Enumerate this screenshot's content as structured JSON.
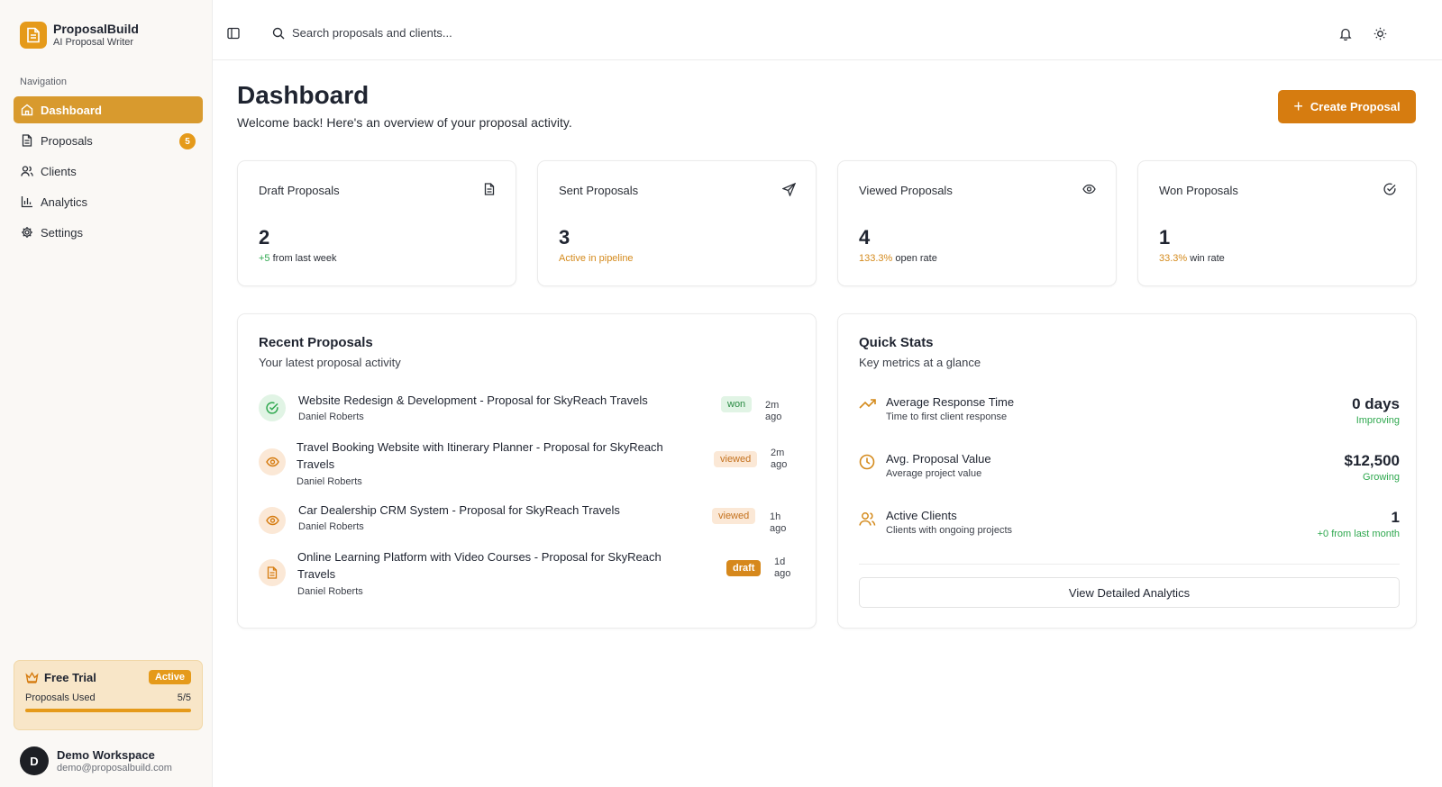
{
  "brand": {
    "name": "ProposalBuild",
    "tagline": "AI Proposal Writer"
  },
  "sidebar": {
    "section_label": "Navigation",
    "items": [
      {
        "label": "Dashboard",
        "icon": "home-icon",
        "active": true
      },
      {
        "label": "Proposals",
        "icon": "document-icon",
        "badge": "5"
      },
      {
        "label": "Clients",
        "icon": "users-icon"
      },
      {
        "label": "Analytics",
        "icon": "bar-chart-icon"
      },
      {
        "label": "Settings",
        "icon": "gear-icon"
      }
    ],
    "trial": {
      "title": "Free Trial",
      "status": "Active",
      "usage_label": "Proposals Used",
      "usage_value": "5/5",
      "usage_fraction": 1.0
    },
    "user": {
      "initial": "D",
      "name": "Demo Workspace",
      "email": "demo@proposalbuild.com"
    }
  },
  "header": {
    "search_placeholder": "Search proposals and clients..."
  },
  "page": {
    "title": "Dashboard",
    "subtitle": "Welcome back! Here's an overview of your proposal activity.",
    "create_button": "Create Proposal"
  },
  "stats": [
    {
      "title": "Draft Proposals",
      "value": "2",
      "highlight": "+5",
      "rest": " from last week",
      "icon": "document-icon"
    },
    {
      "title": "Sent Proposals",
      "value": "3",
      "highlight": "Active in pipeline",
      "rest": "",
      "icon": "send-icon"
    },
    {
      "title": "Viewed Proposals",
      "value": "4",
      "highlight": "133.3%",
      "rest": " open rate",
      "icon": "eye-icon"
    },
    {
      "title": "Won Proposals",
      "value": "1",
      "highlight": "33.3%",
      "rest": " win rate",
      "icon": "check-circle-icon"
    }
  ],
  "recent": {
    "title": "Recent Proposals",
    "subtitle": "Your latest proposal activity",
    "items": [
      {
        "title": "Website Redesign & Development - Proposal for SkyReach Travels",
        "author": "Daniel Roberts",
        "status": "won",
        "time": "2m ago"
      },
      {
        "title": "Travel Booking Website with Itinerary Planner - Proposal for SkyReach Travels",
        "author": "Daniel Roberts",
        "status": "viewed",
        "time": "2m ago"
      },
      {
        "title": "Car Dealership CRM System - Proposal for SkyReach Travels",
        "author": "Daniel Roberts",
        "status": "viewed",
        "time": "1h ago"
      },
      {
        "title": "Online Learning Platform with Video Courses - Proposal for SkyReach Travels",
        "author": "Daniel Roberts",
        "status": "draft",
        "time": "1d ago"
      }
    ]
  },
  "quick_stats": {
    "title": "Quick Stats",
    "subtitle": "Key metrics at a glance",
    "items": [
      {
        "label": "Average Response Time",
        "sub": "Time to first client response",
        "value": "0 days",
        "trend": "Improving",
        "icon": "trending-up-icon"
      },
      {
        "label": "Avg. Proposal Value",
        "sub": "Average project value",
        "value": "$12,500",
        "trend": "Growing",
        "icon": "clock-icon"
      },
      {
        "label": "Active Clients",
        "sub": "Clients with ongoing projects",
        "value": "1",
        "trend": "+0 from last month",
        "icon": "users-icon"
      }
    ],
    "button": "View Detailed Analytics"
  },
  "colors": {
    "accent": "#e59a1a",
    "accent_dark": "#d67c10",
    "positive": "#2fa84f",
    "warning": "#d48a1c"
  }
}
